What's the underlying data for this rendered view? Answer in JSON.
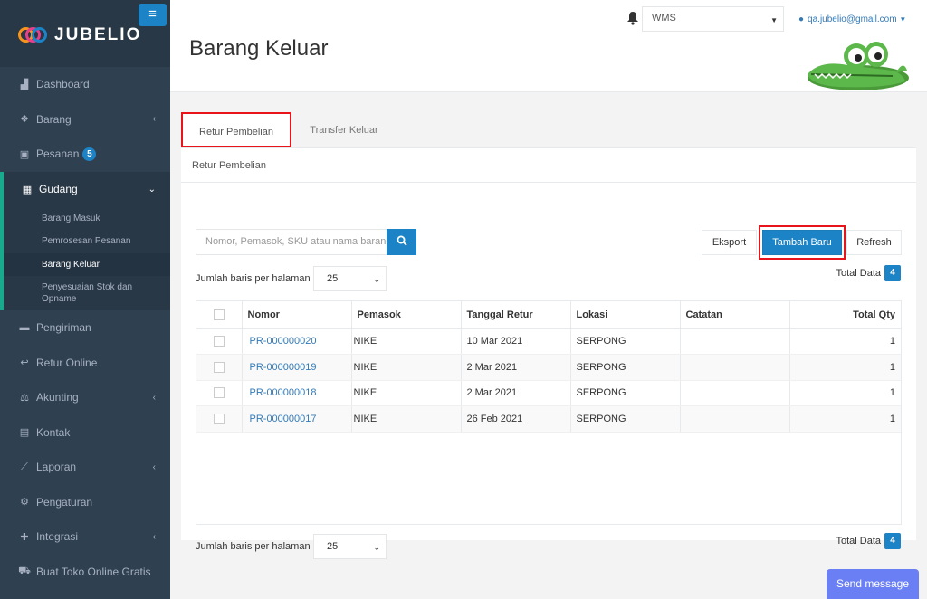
{
  "brand": {
    "name": "JUBELIO"
  },
  "sidebar": {
    "items": [
      {
        "label": "Dashboard",
        "icon": "chart-area-icon"
      },
      {
        "label": "Barang",
        "icon": "cubes-icon",
        "has_submenu": true
      },
      {
        "label": "Pesanan",
        "icon": "gift-icon",
        "badge": "5"
      },
      {
        "label": "Gudang",
        "icon": "building-icon",
        "has_submenu": true,
        "expanded": true
      },
      {
        "label": "Pengiriman",
        "icon": "truck-icon"
      },
      {
        "label": "Retur Online",
        "icon": "reply-icon"
      },
      {
        "label": "Akunting",
        "icon": "balance-scale-icon",
        "has_submenu": true
      },
      {
        "label": "Kontak",
        "icon": "address-card-icon"
      },
      {
        "label": "Laporan",
        "icon": "line-chart-icon",
        "has_submenu": true
      },
      {
        "label": "Pengaturan",
        "icon": "cogs-icon"
      },
      {
        "label": "Integrasi",
        "icon": "puzzle-icon",
        "has_submenu": true
      },
      {
        "label": "Buat Toko Online Gratis",
        "icon": "shopping-cart-icon"
      }
    ],
    "gudang_sub": [
      "Barang Masuk",
      "Pemrosesan Pesanan",
      "Barang Keluar",
      "Penyesuaian Stok dan Opname"
    ]
  },
  "header": {
    "title": "Barang Keluar",
    "location_select": "WMS",
    "user_email": "qa.jubelio@gmail.com"
  },
  "tabs": [
    "Retur Pembelian",
    "Transfer Keluar"
  ],
  "panel": {
    "title": "Retur Pembelian",
    "search_placeholder": "Nomor, Pemasok, SKU atau nama barang",
    "buttons": {
      "export": "Eksport",
      "add": "Tambah Baru",
      "refresh": "Refresh"
    },
    "rows_label": "Jumlah baris per halaman",
    "rows_value": "25",
    "total_label": "Total Data",
    "total_value": "4"
  },
  "table": {
    "columns": [
      "Nomor",
      "Pemasok",
      "Tanggal Retur",
      "Lokasi",
      "Catatan",
      "Total Qty"
    ],
    "rows": [
      {
        "nomor": "PR-000000020",
        "pemasok": "NIKE",
        "tanggal": "10 Mar 2021",
        "lokasi": "SERPONG",
        "catatan": "",
        "qty": "1"
      },
      {
        "nomor": "PR-000000019",
        "pemasok": "NIKE",
        "tanggal": "2 Mar 2021",
        "lokasi": "SERPONG",
        "catatan": "",
        "qty": "1"
      },
      {
        "nomor": "PR-000000018",
        "pemasok": "NIKE",
        "tanggal": "2 Mar 2021",
        "lokasi": "SERPONG",
        "catatan": "",
        "qty": "1"
      },
      {
        "nomor": "PR-000000017",
        "pemasok": "NIKE",
        "tanggal": "26 Feb 2021",
        "lokasi": "SERPONG",
        "catatan": "",
        "qty": "1"
      }
    ]
  },
  "chat": {
    "label": "Send message"
  },
  "colors": {
    "sidebar": "#2f4050",
    "primary": "#1c84c6",
    "accent": "#19aa8d",
    "highlight": "#e8141b"
  }
}
